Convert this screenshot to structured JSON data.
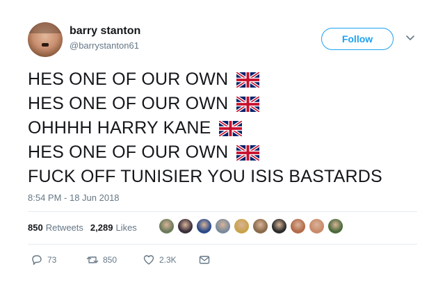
{
  "user": {
    "name": "barry stanton",
    "handle": "@barrystanton61",
    "follow_label": "Follow"
  },
  "tweet": {
    "lines": [
      {
        "text": "HES ONE OF OUR OWN",
        "flag": true
      },
      {
        "text": "HES ONE OF OUR OWN",
        "flag": true
      },
      {
        "text": "OHHHH HARRY KANE",
        "flag": true
      },
      {
        "text": "HES ONE OF OUR OWN",
        "flag": true
      },
      {
        "text": "FUCK OFF TUNISIER YOU ISIS BASTARDS",
        "flag": false
      }
    ],
    "timestamp": "8:54 PM - 18 Jun 2018"
  },
  "stats": {
    "retweets_count": "850",
    "retweets_label": "Retweets",
    "likes_count": "2,289",
    "likes_label": "Likes"
  },
  "likers": [
    {
      "color": "#6b7a5a"
    },
    {
      "color": "#3a2e3a"
    },
    {
      "color": "#2a4a8a"
    },
    {
      "color": "#7a8a9a"
    },
    {
      "color": "#c9a24a"
    },
    {
      "color": "#8a6a4a"
    },
    {
      "color": "#2a2a2a"
    },
    {
      "color": "#b36a4a"
    },
    {
      "color": "#c98a6a"
    },
    {
      "color": "#4a6a3a"
    }
  ],
  "actions": {
    "reply_count": "73",
    "retweet_count": "850",
    "like_count": "2.3K"
  },
  "icons": {
    "reply": "reply-icon",
    "retweet": "retweet-icon",
    "like": "heart-icon",
    "message": "envelope-icon",
    "caret": "chevron-down-icon",
    "flag": "union-jack-flag-icon"
  },
  "colors": {
    "accent": "#1da1f2",
    "text": "#14171a",
    "secondary": "#657786",
    "divider": "#e6ecf0"
  }
}
